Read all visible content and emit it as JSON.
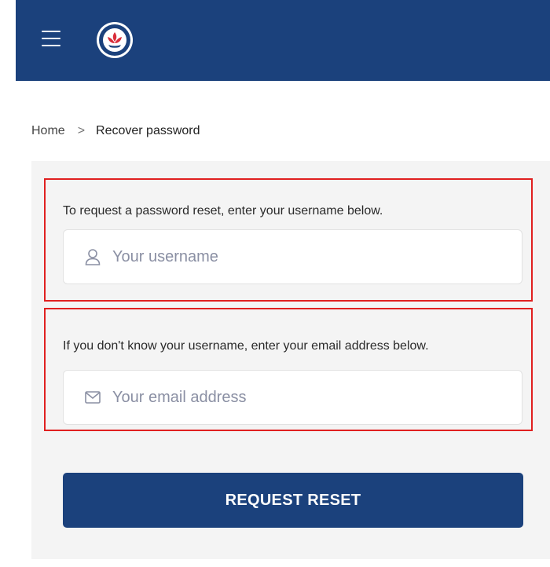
{
  "header": {
    "menu_icon": "hamburger-menu-icon",
    "logo_icon": "lotus-emblem-logo",
    "bg_color": "#1b417c"
  },
  "breadcrumb": {
    "home": "Home",
    "separator": ">",
    "current": "Recover password"
  },
  "username_section": {
    "instruction": "To request a password reset, enter your username below.",
    "placeholder": "Your username",
    "icon": "user-icon"
  },
  "email_section": {
    "instruction": "If you don't know your username, enter your email address below.",
    "placeholder": "Your email address",
    "icon": "envelope-icon"
  },
  "submit": {
    "label": "REQUEST RESET",
    "color": "#1b417c"
  },
  "colors": {
    "highlight_border": "#e02020",
    "panel_bg": "#f4f4f4",
    "placeholder": "#8a8fa3"
  }
}
